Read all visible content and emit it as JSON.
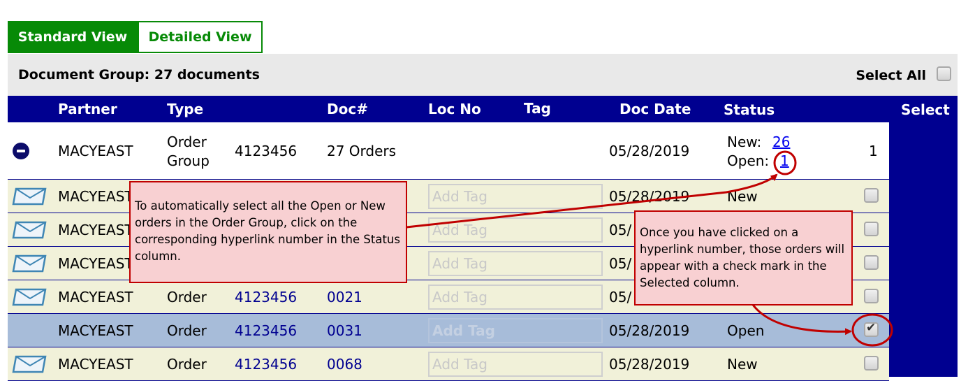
{
  "tabs": {
    "standard": "Standard View",
    "detailed": "Detailed View",
    "active": "standard"
  },
  "group_bar": {
    "title": "Document Group: 27 documents",
    "select_all": "Select All"
  },
  "columns": {
    "partner": "Partner",
    "type": "Type",
    "doc": "Doc#",
    "loc": "Loc No",
    "tag": "Tag",
    "date": "Doc Date",
    "status": "Status",
    "select": "Select"
  },
  "group_row": {
    "icon": "collapse-minus-icon",
    "partner": "MACYEAST",
    "type_line1": "Order",
    "type_line2": "Group",
    "group_no": "4123456",
    "doc": "27 Orders",
    "date": "05/28/2019",
    "new_label": "New:",
    "new_count": "26",
    "open_label": "Open:",
    "open_count": "1",
    "selected_count": "1"
  },
  "tag_placeholder": "Add Tag",
  "rows": [
    {
      "icon": "envelope-icon",
      "partner": "MACYEAST",
      "type": "",
      "group_no": "",
      "doc": "",
      "date": "05/28/2019",
      "status": "New",
      "checked": false,
      "highlight": false
    },
    {
      "icon": "envelope-icon",
      "partner": "MACYEAST",
      "type": "",
      "group_no": "",
      "doc": "",
      "date": "05/",
      "status": "",
      "checked": false,
      "highlight": false
    },
    {
      "icon": "envelope-icon",
      "partner": "MACYEAST",
      "type": "",
      "group_no": "",
      "doc": "",
      "date": "05/",
      "status": "",
      "checked": false,
      "highlight": false
    },
    {
      "icon": "envelope-icon",
      "partner": "MACYEAST",
      "type": "Order",
      "group_no": "4123456",
      "doc": "0021",
      "date": "05/",
      "status": "",
      "checked": false,
      "highlight": false
    },
    {
      "icon": "",
      "partner": "MACYEAST",
      "type": "Order",
      "group_no": "4123456",
      "doc": "0031",
      "date": "05/28/2019",
      "status": "Open",
      "checked": true,
      "highlight": true
    },
    {
      "icon": "envelope-icon",
      "partner": "MACYEAST",
      "type": "Order",
      "group_no": "4123456",
      "doc": "0068",
      "date": "05/28/2019",
      "status": "New",
      "checked": false,
      "highlight": false
    }
  ],
  "callouts": {
    "left": "To automatically select all the Open or New orders in the Order Group, click on the corresponding hyperlink number in the Status column.",
    "right": "Once you have clicked on a hyperlink number, those orders will appear with a check mark in the Selected column."
  },
  "colors": {
    "header": "#000090",
    "tab_green": "#078a07",
    "row_bg": "#f1f1d9",
    "row_selected": "#a7bcd9",
    "callout_bg": "#f8d0d2",
    "callout_border": "#c00000"
  }
}
